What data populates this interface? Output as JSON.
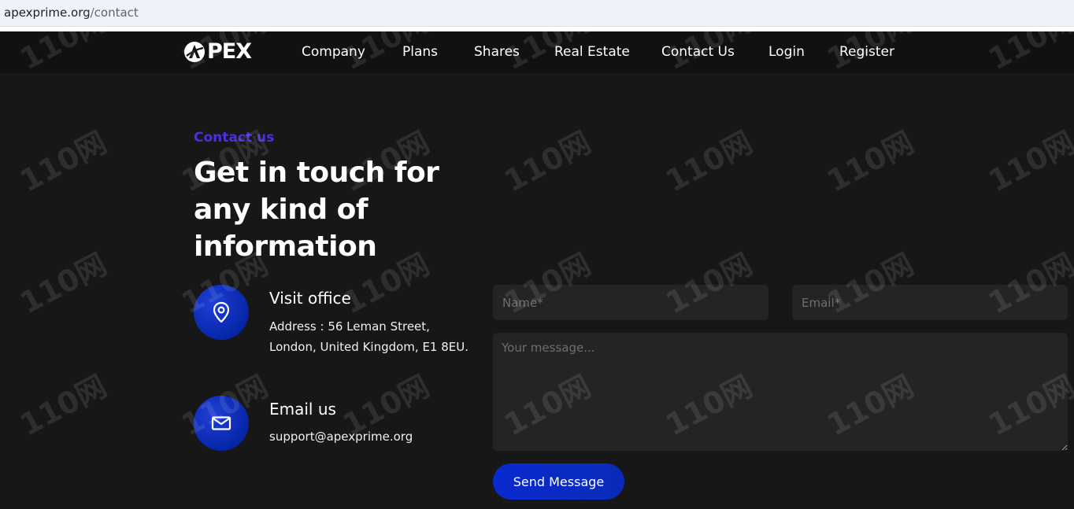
{
  "browser": {
    "url_domain": "apexprime.org",
    "url_path": "/contact"
  },
  "nav": {
    "logo_text": "PEX",
    "links": [
      "Company",
      "Plans",
      "Shares",
      "Real Estate",
      "Contact Us",
      "Login",
      "Register"
    ]
  },
  "hero": {
    "eyebrow": "Contact us",
    "headline": "Get in touch for any kind of information"
  },
  "contact_info": {
    "office": {
      "icon": "location-pin-icon",
      "title": "Visit office",
      "address_line1": "Address : 56 Leman Street,",
      "address_line2": "London, United Kingdom, E1 8EU."
    },
    "email": {
      "icon": "envelope-icon",
      "title": "Email us",
      "value": "support@apexprime.org"
    }
  },
  "form": {
    "name_placeholder": "Name*",
    "email_placeholder": "Email*",
    "message_placeholder": "Your message...",
    "submit_label": "Send Message"
  },
  "watermark": {
    "text": "110网"
  },
  "colors": {
    "background": "#171717",
    "nav_background": "#111111",
    "accent_purple": "#4a2fe0",
    "button_blue": "#0a2ad0",
    "field_background": "#242424"
  }
}
